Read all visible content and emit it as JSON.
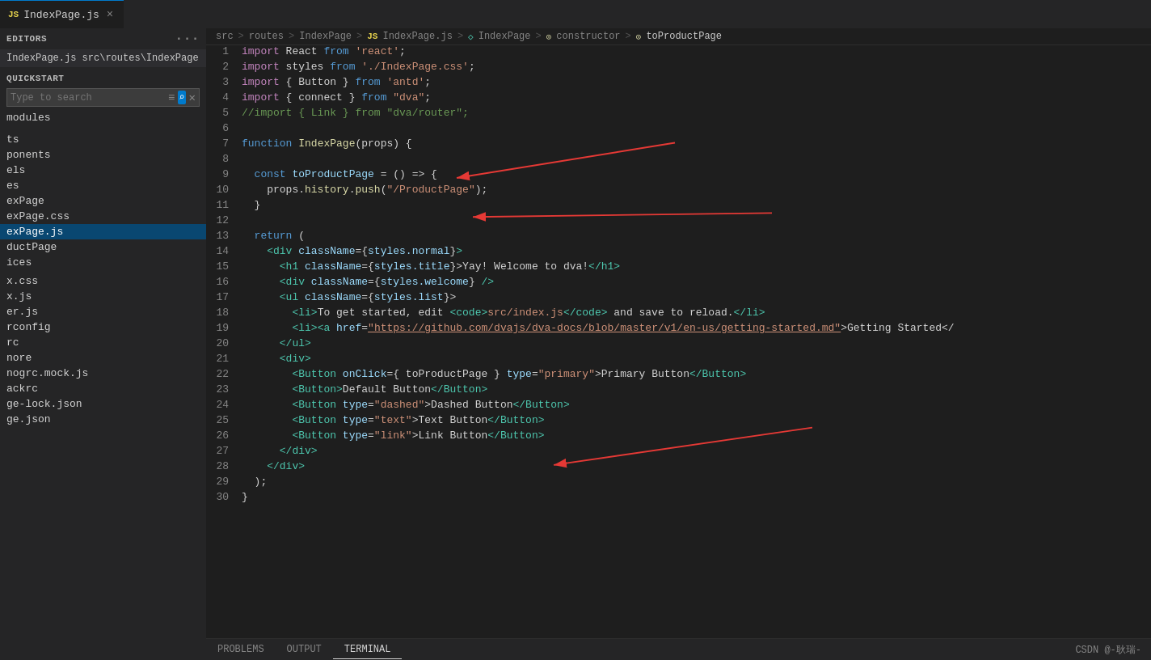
{
  "tab": {
    "icon": "JS",
    "label": "IndexPage.js",
    "close_label": "×"
  },
  "breadcrumb": {
    "items": [
      "src",
      "routes",
      "IndexPage",
      "IndexPage.js",
      "IndexPage",
      "constructor",
      "toProductPage"
    ],
    "separators": [
      ">",
      ">",
      ">",
      ">",
      ">",
      ">"
    ]
  },
  "sidebar": {
    "header_dots": "···",
    "editors_label": "EDITORS",
    "open_file": "IndexPage.js  src\\routes\\IndexPage",
    "quickstart_label": "QUICKSTART",
    "search_placeholder": "Type to search",
    "tree_items": [
      {
        "label": "modules",
        "indent": 0
      },
      {
        "label": "",
        "indent": 0
      },
      {
        "label": "",
        "indent": 0
      },
      {
        "label": "ts",
        "indent": 0
      },
      {
        "label": "ponents",
        "indent": 0
      },
      {
        "label": "els",
        "indent": 0
      },
      {
        "label": "es",
        "indent": 0
      },
      {
        "label": "exPage",
        "indent": 0
      },
      {
        "label": "exPage.css",
        "indent": 0
      },
      {
        "label": "exPage.js",
        "indent": 0,
        "active": true
      },
      {
        "label": "ductPage",
        "indent": 0
      },
      {
        "label": "ices",
        "indent": 0
      },
      {
        "label": "",
        "indent": 0
      },
      {
        "label": "x.css",
        "indent": 0
      },
      {
        "label": "x.js",
        "indent": 0
      },
      {
        "label": "er.js",
        "indent": 0
      },
      {
        "label": "rconfig",
        "indent": 0
      },
      {
        "label": "rc",
        "indent": 0
      },
      {
        "label": "nore",
        "indent": 0
      },
      {
        "label": "nogrc.mock.js",
        "indent": 0
      },
      {
        "label": "ackrc",
        "indent": 0
      },
      {
        "label": "ge-lock.json",
        "indent": 0
      },
      {
        "label": "ge.json",
        "indent": 0
      }
    ]
  },
  "code": {
    "lines": [
      {
        "n": 1,
        "tokens": [
          {
            "t": "kw2",
            "v": "import"
          },
          {
            "t": "",
            "v": " React "
          },
          {
            "t": "kw",
            "v": "from"
          },
          {
            "t": "str",
            "v": " 'react'"
          }
        ],
        "plain": "import React from 'react';"
      },
      {
        "n": 2,
        "tokens": [
          {
            "t": "kw2",
            "v": "import"
          },
          {
            "t": "",
            "v": " styles "
          },
          {
            "t": "kw",
            "v": "from"
          },
          {
            "t": "str",
            "v": " './IndexPage.css'"
          }
        ],
        "plain": "import styles from './IndexPage.css';"
      },
      {
        "n": 3,
        "tokens": [
          {
            "t": "kw2",
            "v": "import"
          },
          {
            "t": "",
            "v": " { Button } "
          },
          {
            "t": "kw",
            "v": "from"
          },
          {
            "t": "str",
            "v": " 'antd'"
          }
        ],
        "plain": "import { Button } from 'antd';"
      },
      {
        "n": 4,
        "tokens": [
          {
            "t": "kw2",
            "v": "import"
          },
          {
            "t": "",
            "v": " { connect } "
          },
          {
            "t": "kw",
            "v": "from"
          },
          {
            "t": "str",
            "v": " \"dva\""
          }
        ],
        "plain": "import { connect } from \"dva\";"
      },
      {
        "n": 5,
        "tokens": [
          {
            "t": "comment",
            "v": "//import { Link } from \"dva/router\";"
          }
        ],
        "plain": "//import { Link } from \"dva/router\";"
      },
      {
        "n": 6,
        "tokens": [],
        "plain": ""
      },
      {
        "n": 7,
        "tokens": [
          {
            "t": "kw",
            "v": "function"
          },
          {
            "t": "fn",
            "v": " IndexPage"
          },
          {
            "t": "",
            "v": "(props) {"
          }
        ],
        "plain": "function IndexPage(props) {"
      },
      {
        "n": 8,
        "tokens": [],
        "plain": ""
      },
      {
        "n": 9,
        "tokens": [
          {
            "t": "",
            "v": "  "
          },
          {
            "t": "kw",
            "v": "const"
          },
          {
            "t": "prop",
            "v": " toProductPage"
          },
          {
            "t": "",
            "v": " = () => {"
          }
        ],
        "plain": "  const toProductPage = () => {"
      },
      {
        "n": 10,
        "tokens": [
          {
            "t": "",
            "v": "    props."
          },
          {
            "t": "method",
            "v": "history"
          },
          {
            "t": "",
            "v": "."
          },
          {
            "t": "method",
            "v": "push"
          },
          {
            "t": "",
            "v": "("
          },
          {
            "t": "str",
            "v": "\"/ProductPage\""
          },
          {
            "t": "",
            "v": ");"
          }
        ],
        "plain": "    props.history.push(\"/ProductPage\");"
      },
      {
        "n": 11,
        "tokens": [
          {
            "t": "",
            "v": "  }"
          }
        ],
        "plain": "  }"
      },
      {
        "n": 12,
        "tokens": [],
        "plain": ""
      },
      {
        "n": 13,
        "tokens": [
          {
            "t": "kw",
            "v": "  return"
          },
          {
            "t": "",
            "v": " ("
          }
        ],
        "plain": "  return ("
      },
      {
        "n": 14,
        "tokens": [
          {
            "t": "",
            "v": "    "
          },
          {
            "t": "tag",
            "v": "<div"
          },
          {
            "t": "attr",
            "v": " className"
          },
          {
            "t": "",
            "v": "={"
          },
          {
            "t": "prop",
            "v": "styles.normal"
          },
          {
            "t": "",
            "v": "}"
          },
          {
            "t": "tag",
            "v": ">"
          }
        ],
        "plain": "    <div className={styles.normal}>"
      },
      {
        "n": 15,
        "tokens": [
          {
            "t": "",
            "v": "      "
          },
          {
            "t": "tag",
            "v": "<h1"
          },
          {
            "t": "attr",
            "v": " className"
          },
          {
            "t": "",
            "v": "={"
          },
          {
            "t": "prop",
            "v": "styles.title"
          },
          {
            "t": "",
            "v": "}>"
          },
          {
            "t": "",
            "v": "Yay! Welcome to dva!"
          },
          {
            "t": "tag",
            "v": "</h1>"
          }
        ],
        "plain": "      <h1 className={styles.title}>Yay! Welcome to dva!</h1>"
      },
      {
        "n": 16,
        "tokens": [
          {
            "t": "",
            "v": "      "
          },
          {
            "t": "tag",
            "v": "<div"
          },
          {
            "t": "attr",
            "v": " className"
          },
          {
            "t": "",
            "v": "={"
          },
          {
            "t": "prop",
            "v": "styles.welcome"
          },
          {
            "t": "",
            "v": "} "
          },
          {
            "t": "tag",
            "v": "/>"
          }
        ],
        "plain": "      <div className={styles.welcome} />"
      },
      {
        "n": 17,
        "tokens": [
          {
            "t": "",
            "v": "      "
          },
          {
            "t": "tag",
            "v": "<ul"
          },
          {
            "t": "attr",
            "v": " className"
          },
          {
            "t": "",
            "v": "={"
          },
          {
            "t": "prop",
            "v": "styles.list"
          },
          {
            "t": "",
            "v": "}>"
          },
          {
            "t": "tag",
            "v": ""
          }
        ],
        "plain": "      <ul className={styles.list}>"
      },
      {
        "n": 18,
        "tokens": [
          {
            "t": "",
            "v": "        "
          },
          {
            "t": "tag",
            "v": "<li>"
          },
          {
            "t": "",
            "v": "To get started, edit "
          },
          {
            "t": "tag",
            "v": "<code>"
          },
          {
            "t": "str",
            "v": "src/index.js"
          },
          {
            "t": "tag",
            "v": "</code>"
          },
          {
            "t": "",
            "v": " and save to reload."
          },
          {
            "t": "tag",
            "v": "</li>"
          }
        ],
        "plain": "        <li>To get started, edit <code>src/index.js</code> and save to reload.</li>"
      },
      {
        "n": 19,
        "tokens": [
          {
            "t": "",
            "v": "        "
          },
          {
            "t": "tag",
            "v": "<li>"
          },
          {
            "t": "tag",
            "v": "<a"
          },
          {
            "t": "attr",
            "v": " href"
          },
          {
            "t": "",
            "v": "="
          },
          {
            "t": "str-url",
            "v": "\"https://github.com/dvajs/dva-docs/blob/master/v1/en-us/getting-started.md\""
          },
          {
            "t": "",
            "v": ">"
          },
          {
            "t": "",
            "v": "Getting Started</"
          }
        ],
        "plain": "        <li><a href=\"https://github.com/dvajs/dva-docs/blob/master/v1/en-us/getting-started.md\">Getting Started</"
      },
      {
        "n": 20,
        "tokens": [
          {
            "t": "",
            "v": "      "
          },
          {
            "t": "tag",
            "v": "</ul>"
          }
        ],
        "plain": "      </ul>"
      },
      {
        "n": 21,
        "tokens": [
          {
            "t": "",
            "v": "      "
          },
          {
            "t": "tag",
            "v": "<div>"
          }
        ],
        "plain": "      <div>"
      },
      {
        "n": 22,
        "tokens": [
          {
            "t": "",
            "v": "        "
          },
          {
            "t": "tag",
            "v": "<Button"
          },
          {
            "t": "attr",
            "v": " onClick"
          },
          {
            "t": "",
            "v": "={ toProductPage } "
          },
          {
            "t": "attr",
            "v": "type"
          },
          {
            "t": "",
            "v": "="
          },
          {
            "t": "attr-val",
            "v": "\"primary\""
          },
          {
            "t": "",
            "v": ">"
          },
          {
            "t": "",
            "v": "Primary Button"
          },
          {
            "t": "tag",
            "v": "</Button>"
          }
        ],
        "plain": "        <Button onClick={ toProductPage } type=\"primary\">Primary Button</Button>"
      },
      {
        "n": 23,
        "tokens": [
          {
            "t": "",
            "v": "        "
          },
          {
            "t": "tag",
            "v": "<Button>"
          },
          {
            "t": "",
            "v": "Default Button"
          },
          {
            "t": "tag",
            "v": "</Button>"
          }
        ],
        "plain": "        <Button>Default Button</Button>"
      },
      {
        "n": 24,
        "tokens": [
          {
            "t": "",
            "v": "        "
          },
          {
            "t": "tag",
            "v": "<Button"
          },
          {
            "t": "attr",
            "v": " type"
          },
          {
            "t": "",
            "v": "="
          },
          {
            "t": "attr-val",
            "v": "\"dashed\""
          },
          {
            "t": "",
            "v": ">"
          },
          {
            "t": "",
            "v": "Dashed Button"
          },
          {
            "t": "tag",
            "v": "</Button>"
          }
        ],
        "plain": "        <Button type=\"dashed\">Dashed Button</Button>"
      },
      {
        "n": 25,
        "tokens": [
          {
            "t": "",
            "v": "        "
          },
          {
            "t": "tag",
            "v": "<Button"
          },
          {
            "t": "attr",
            "v": " type"
          },
          {
            "t": "",
            "v": "="
          },
          {
            "t": "attr-val",
            "v": "\"text\""
          },
          {
            "t": "",
            "v": ">"
          },
          {
            "t": "",
            "v": "Text Button"
          },
          {
            "t": "tag",
            "v": "</Button>"
          }
        ],
        "plain": "        <Button type=\"text\">Text Button</Button>"
      },
      {
        "n": 26,
        "tokens": [
          {
            "t": "",
            "v": "        "
          },
          {
            "t": "tag",
            "v": "<Button"
          },
          {
            "t": "attr",
            "v": " type"
          },
          {
            "t": "",
            "v": "="
          },
          {
            "t": "attr-val",
            "v": "\"link\""
          },
          {
            "t": "",
            "v": ">"
          },
          {
            "t": "",
            "v": "Link Button"
          },
          {
            "t": "tag",
            "v": "</Button>"
          }
        ],
        "plain": "        <Button type=\"link\">Link Button</Button>"
      },
      {
        "n": 27,
        "tokens": [
          {
            "t": "",
            "v": "      "
          },
          {
            "t": "tag",
            "v": "</div>"
          }
        ],
        "plain": "      </div>"
      },
      {
        "n": 28,
        "tokens": [
          {
            "t": "",
            "v": "    "
          },
          {
            "t": "tag",
            "v": "</div>"
          }
        ],
        "plain": "    </div>"
      },
      {
        "n": 29,
        "tokens": [
          {
            "t": "",
            "v": "  );"
          }
        ],
        "plain": "  );"
      },
      {
        "n": 30,
        "tokens": [
          {
            "t": "",
            "v": "}"
          }
        ],
        "plain": "}"
      }
    ]
  },
  "bottom_tabs": {
    "items": [
      "PROBLEMS",
      "OUTPUT",
      "TERMINAL"
    ],
    "active": "TERMINAL"
  },
  "bottom_right_label": "CSDN @-耿瑞-",
  "ui": {
    "filter_icon": "≡",
    "search_icon": "⌕",
    "close_icon": "✕",
    "tab_close": "×",
    "dots": "···"
  }
}
